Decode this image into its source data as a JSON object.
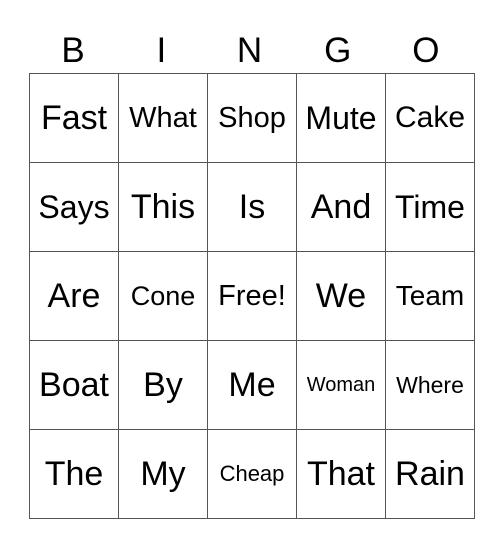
{
  "header": [
    "B",
    "I",
    "N",
    "G",
    "O"
  ],
  "rows": [
    [
      {
        "text": "Fast",
        "size": 34
      },
      {
        "text": "What",
        "size": 29
      },
      {
        "text": "Shop",
        "size": 29
      },
      {
        "text": "Mute",
        "size": 32
      },
      {
        "text": "Cake",
        "size": 30
      }
    ],
    [
      {
        "text": "Says",
        "size": 32
      },
      {
        "text": "This",
        "size": 34
      },
      {
        "text": "Is",
        "size": 34
      },
      {
        "text": "And",
        "size": 34
      },
      {
        "text": "Time",
        "size": 32
      }
    ],
    [
      {
        "text": "Are",
        "size": 34
      },
      {
        "text": "Cone",
        "size": 27
      },
      {
        "text": "Free!",
        "size": 29
      },
      {
        "text": "We",
        "size": 34
      },
      {
        "text": "Team",
        "size": 28
      }
    ],
    [
      {
        "text": "Boat",
        "size": 34
      },
      {
        "text": "By",
        "size": 34
      },
      {
        "text": "Me",
        "size": 34
      },
      {
        "text": "Woman",
        "size": 20
      },
      {
        "text": "Where",
        "size": 23
      }
    ],
    [
      {
        "text": "The",
        "size": 34
      },
      {
        "text": "My",
        "size": 34
      },
      {
        "text": "Cheap",
        "size": 22
      },
      {
        "text": "That",
        "size": 34
      },
      {
        "text": "Rain",
        "size": 34
      }
    ]
  ]
}
